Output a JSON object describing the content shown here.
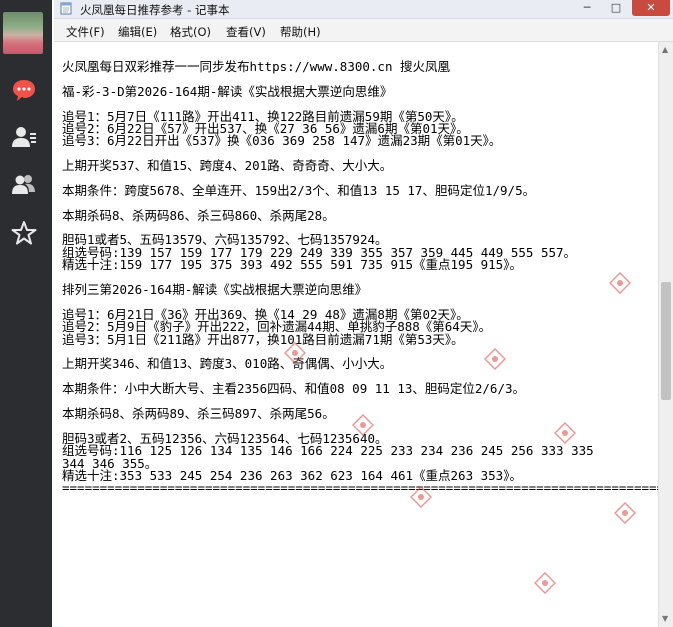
{
  "window": {
    "title": "火凤凰每日推荐参考 - 记事本",
    "minimize": "─",
    "maximize": "□",
    "close": "✕"
  },
  "menu": [
    "文件(F)",
    "编辑(E)",
    "格式(O)",
    "查看(V)",
    "帮助(H)"
  ],
  "sidebar": {
    "icons": [
      "chat-icon",
      "contacts-icon",
      "groups-icon",
      "favorites-icon"
    ]
  },
  "document": {
    "lines": [
      "火凤凰每日双彩推荐一一同步发布https://www.8300.cn 搜火凤凰",
      "",
      "福-彩-3-D第2026-164期-解读《实战根据大票逆向思维》",
      "",
      "追号1：5月7日《111路》开出411、换122路目前遗漏59期《第50天》。",
      "追号2：6月22日《57》开出537、换《27 36 56》遗漏6期《第01天》。",
      "追号3：6月22日开出《537》换《036 369 258 147》遗漏23期《第01天》。",
      "",
      "上期开奖537、和值15、跨度4、201路、奇奇奇、大小大。",
      "",
      "本期条件：跨度5678、全单连开、159出2/3个、和值13 15 17、胆码定位1/9/5。",
      "",
      "本期杀码8、杀两码86、杀三码860、杀两尾28。",
      "",
      "胆码1或者5、五码13579、六码135792、七码1357924。",
      "组选号码:139 157 159 177 179 229 249 339 355 357 359 445 449 555 557。",
      "精选十注:159 177 195 375 393 492 555 591 735 915《重点195 915》。",
      "",
      "排列三第2026-164期-解读《实战根据大票逆向思维》",
      "",
      "追号1：6月21日《36》开出369、换《14 29 48》遗漏8期《第02天》。",
      "追号2：5月9日《豹子》开出222，回补遗漏44期、单挑豹子888《第64天》。",
      "追号3：5月1日《211路》开出877，换101路目前遗漏71期《第53天》。",
      "",
      "上期开奖346、和值13、跨度3、010路、奇偶偶、小小大。",
      "",
      "本期条件：小中大断大号、主看2356四码、和值08 09 11 13、胆码定位2/6/3。",
      "",
      "本期杀码8、杀两码89、杀三码897、杀两尾56。",
      "",
      "胆码3或者2、五码12356、六码123564、七码1235640。",
      "组选号码:116 125 126 134 135 146 166 224 225 233 234 236 245 256 333 335",
      "344 346 355。",
      "精选十注:353 533 245 254 236 263 362 623 164 461《重点263 353》。",
      "================================================================================"
    ]
  },
  "colors": {
    "sidebar_bg": "#2c2d31",
    "chat_icon_red": "#f0524a",
    "titlebar_bg": "#e9edf3",
    "menubar_bg": "#f3f3f3",
    "watermark_red": "#e0443d"
  }
}
